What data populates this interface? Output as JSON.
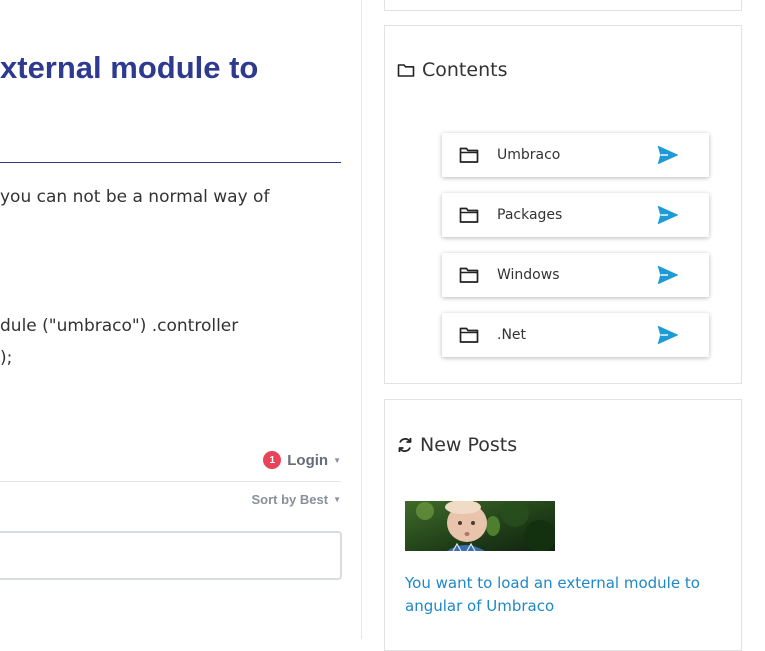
{
  "article": {
    "title": "xternal module to",
    "para1": " you can not be a normal way of",
    "code_line1": "dule (\"umbraco\") .controller",
    "code_line2": ");"
  },
  "disqus": {
    "badge_count": "1",
    "login_label": "Login",
    "sort_label": "Sort by Best"
  },
  "sidebar": {
    "contents_heading": "Contents",
    "categories": [
      {
        "label": "Umbraco"
      },
      {
        "label": "Packages"
      },
      {
        "label": "Windows"
      },
      {
        "label": ".Net"
      }
    ],
    "new_posts_heading": "New Posts",
    "post_link": "You want to load an external module to angular of Umbraco"
  },
  "colors": {
    "title": "#2e3a8f",
    "link": "#1e88c7",
    "send_icon": "#1e9ad6",
    "badge": "#e8435a"
  },
  "icons": [
    "folder-icon",
    "send-icon",
    "refresh-icon",
    "caret-down-icon"
  ]
}
